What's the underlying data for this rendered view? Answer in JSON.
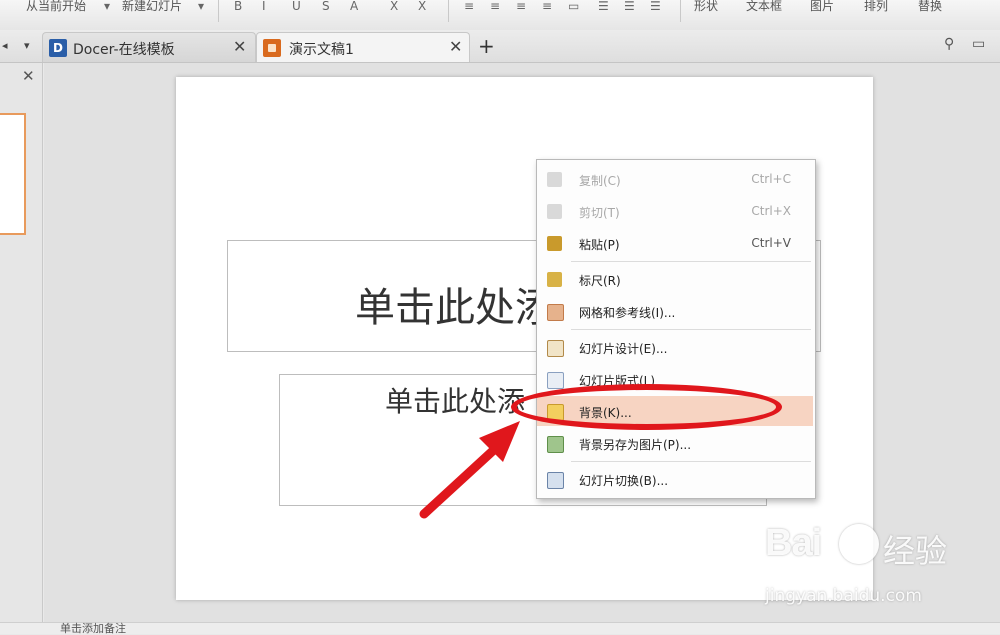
{
  "toolbar": {
    "items": [
      "从当前开始",
      "新建幻灯片",
      "形状",
      "文本框",
      "图片",
      "排列",
      "替换"
    ]
  },
  "tabs": [
    {
      "label": "Docer-在线模板",
      "icon": "docer-icon"
    },
    {
      "label": "演示文稿1",
      "icon": "presentation-doc-icon"
    }
  ],
  "slide": {
    "title_placeholder": "单击此处添",
    "subtitle_placeholder": "单击此处添"
  },
  "context_menu": {
    "items": [
      {
        "label": "复制(C)",
        "shortcut": "Ctrl+C",
        "icon": "copy-icon",
        "enabled": false
      },
      {
        "label": "剪切(T)",
        "shortcut": "Ctrl+X",
        "icon": "cut-icon",
        "enabled": false
      },
      {
        "label": "粘贴(P)",
        "shortcut": "Ctrl+V",
        "icon": "paste-icon",
        "enabled": true
      },
      {
        "label": "标尺(R)",
        "shortcut": "",
        "icon": "ruler-icon",
        "enabled": true
      },
      {
        "label": "网格和参考线(I)...",
        "shortcut": "",
        "icon": "grid-icon",
        "enabled": true
      },
      {
        "label": "幻灯片设计(E)...",
        "shortcut": "",
        "icon": "slide-design-icon",
        "enabled": true
      },
      {
        "label": "幻灯片版式(L)",
        "shortcut": "",
        "icon": "slide-layout-icon",
        "enabled": true
      },
      {
        "label": "背景(K)...",
        "shortcut": "",
        "icon": "background-icon",
        "enabled": true,
        "highlighted": true
      },
      {
        "label": "背景另存为图片(P)...",
        "shortcut": "",
        "icon": "save-background-icon",
        "enabled": true
      },
      {
        "label": "幻灯片切换(B)...",
        "shortcut": "",
        "icon": "slide-transition-icon",
        "enabled": true
      }
    ]
  },
  "statusbar": {
    "text": "单击添加备注"
  },
  "watermark": {
    "brand": "Bai",
    "brand_cn": "经验",
    "url": "jingyan.baidu.com"
  },
  "colors": {
    "highlight": "#f7d4c2",
    "annotation": "#e0171c",
    "thumb_border": "#e89a5c"
  }
}
